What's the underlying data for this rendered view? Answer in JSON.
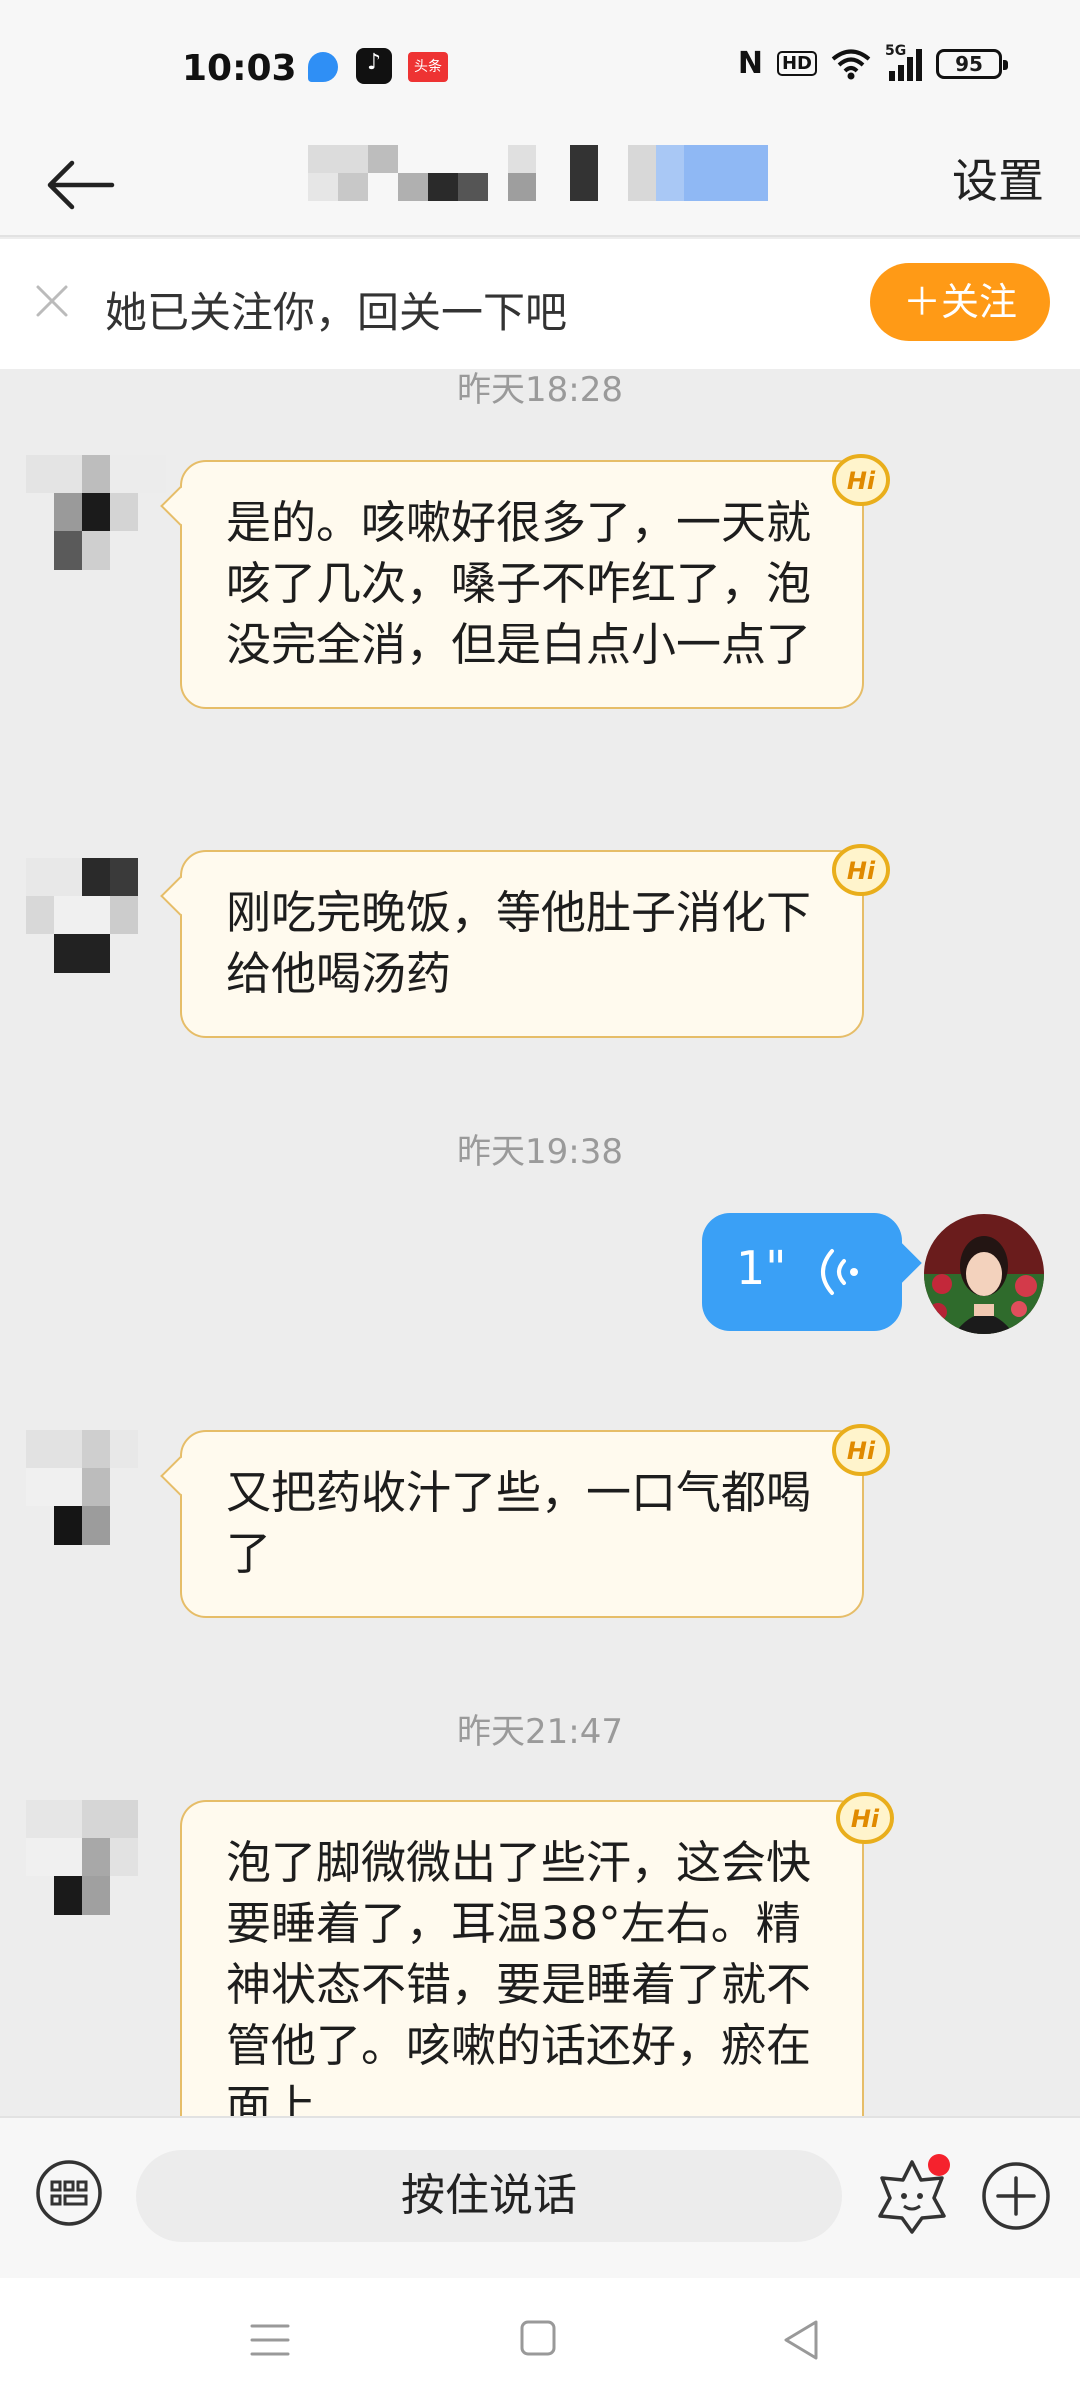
{
  "status_bar": {
    "time": "10:03",
    "toutiao_label": "头条",
    "tiktok_glyph": "♪",
    "nfc_label": "N",
    "hd_label": "HD",
    "signal_label": "5G",
    "battery": "95",
    "icons": [
      "wifi-icon",
      "signal-icon",
      "battery-icon"
    ]
  },
  "nav": {
    "settings_label": "设置"
  },
  "follow_banner": {
    "text": "她已关注你，回关一下吧",
    "button_label": "＋关注",
    "button_color": "#ff9a16"
  },
  "messages": [
    {
      "time": "昨天18:28",
      "text": "是的。咳嗽好很多了，一天就咳了几次，嗓子不咋红了，泡没完全消，但是白点小一点了"
    },
    {
      "text": "刚吃完晚饭，等他肚子消化下给他喝汤药"
    },
    {
      "time": "昨天19:38",
      "voice_duration": "1\""
    },
    {
      "text": "又把药收汁了些，一口气都喝了"
    },
    {
      "time": "昨天21:47",
      "text": "泡了脚微微出了些汗，这会快要睡着了，耳温38°左右。精神状态不错，要是睡着了就不管他了。咳嗽的话还好，瘀在面上"
    }
  ],
  "hi_badge": "Hi",
  "input_bar": {
    "hold_to_talk_label": "按住说话"
  },
  "colors": {
    "incoming_bubble_bg": "#fffaee",
    "incoming_bubble_border": "#e6bd68",
    "outgoing_bubble_bg": "#3aa0f6"
  }
}
